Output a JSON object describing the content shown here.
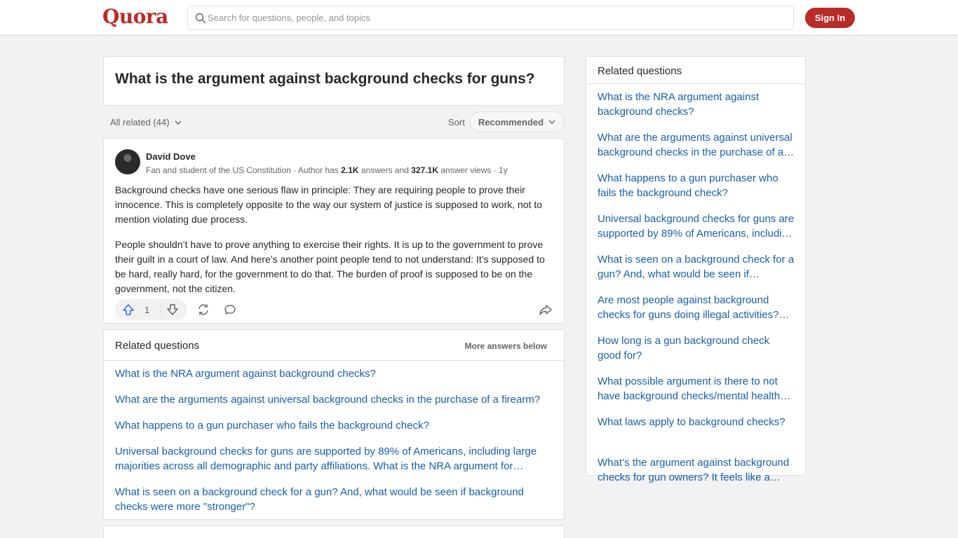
{
  "header": {
    "logo": "Quora",
    "search_placeholder": "Search for questions, people, and topics",
    "signin_label": "Sign In"
  },
  "question": {
    "title": "What is the argument against background checks for guns?"
  },
  "filters": {
    "all_related": "All related (44)",
    "sort_label": "Sort",
    "sort_value": "Recommended"
  },
  "answer": {
    "author": "David Dove",
    "credential": "Fan and student of the US Constitution",
    "meta_prefix": "Author has",
    "answers_count": "2.1K",
    "answers_word": "answers and",
    "views_count": "327.1K",
    "views_word": "answer views",
    "age": "1y",
    "paragraphs": [
      "Background checks have one serious flaw in principle: They are requiring people to prove their innocence. This is completely opposite to the way our system of justice is supposed to work, not to mention violating due process.",
      "People shouldn’t have to prove anything to exercise their rights. It is up to the government to prove their guilt in a court of law. And here’s another point people tend to not understand: It’s supposed to be hard, really hard, for the government to do that. The burden of proof is supposed to be on the government, not the citizen."
    ],
    "upvotes": "1"
  },
  "related_inline": {
    "title": "Related questions",
    "more": "More answers below",
    "items": [
      "What is the NRA argument against background checks?",
      "What are the arguments against universal background checks in the purchase of a firearm?",
      "What happens to a gun purchaser who fails the background check?",
      "Universal background checks for guns are supported by 89% of Americans, including large majorities across all demographic and party affiliations. What is the NRA argument for…",
      "What is seen on a background check for a gun? And, what would be seen if background checks were more \"stronger\"?"
    ]
  },
  "sidebar": {
    "title": "Related questions",
    "items": [
      "What is the NRA argument against background checks?",
      "What are the arguments against universal background checks in the purchase of a…",
      "What happens to a gun purchaser who fails the background check?",
      "Universal background checks for guns are supported by 89% of Americans, includi…",
      "What is seen on a background check for a gun? And, what would be seen if…",
      "Are most people against background checks for guns doing illegal activities?…",
      "How long is a gun background check good for?",
      "What possible argument is there to not have background checks/mental health…",
      "What laws apply to background checks?",
      "What’s the argument against background checks for gun owners? It feels like a…"
    ]
  },
  "colors": {
    "brand": "#b92b27",
    "link": "#195faa",
    "upvote": "#2e69ff"
  }
}
